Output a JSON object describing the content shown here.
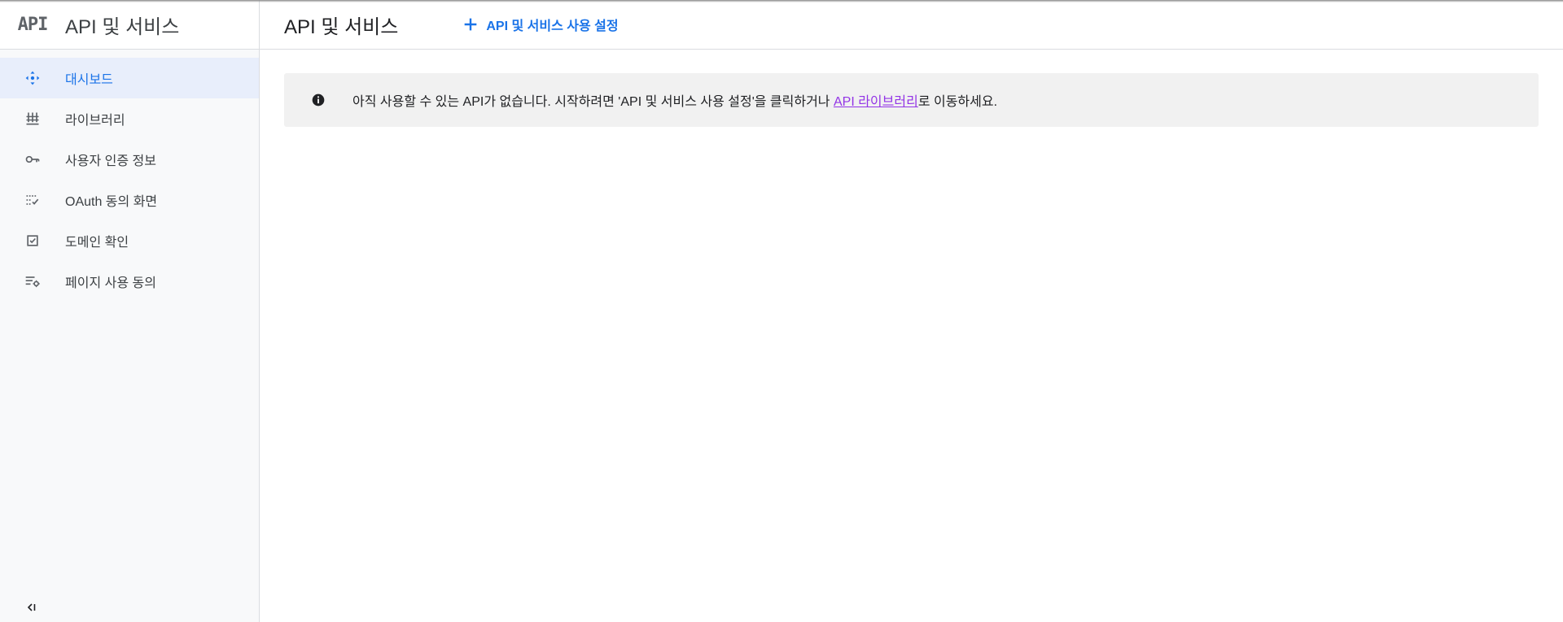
{
  "sidebar": {
    "logo_text": "API",
    "title": "API 및 서비스",
    "items": [
      {
        "label": "대시보드",
        "icon": "dashboard-icon",
        "active": true
      },
      {
        "label": "라이브러리",
        "icon": "library-icon"
      },
      {
        "label": "사용자 인증 정보",
        "icon": "key-icon"
      },
      {
        "label": "OAuth 동의 화면",
        "icon": "oauth-consent-icon"
      },
      {
        "label": "도메인 확인",
        "icon": "domain-check-icon"
      },
      {
        "label": "페이지 사용 동의",
        "icon": "page-consent-icon"
      }
    ],
    "collapse_icon": "collapse-sidebar-icon"
  },
  "header": {
    "title": "API 및 서비스",
    "enable_button": "API 및 서비스 사용 설정"
  },
  "notice": {
    "icon": "info-icon",
    "text_before": "아직 사용할 수 있는 API가 없습니다. 시작하려면 'API 및 서비스 사용 설정'을 클릭하거나 ",
    "link": "API 라이브러리",
    "text_after": "로 이동하세요."
  },
  "colors": {
    "accent": "#1a73e8",
    "link_visited": "#9334e6",
    "active_bg": "#e8eefb",
    "notice_bg": "#f1f1f1"
  }
}
